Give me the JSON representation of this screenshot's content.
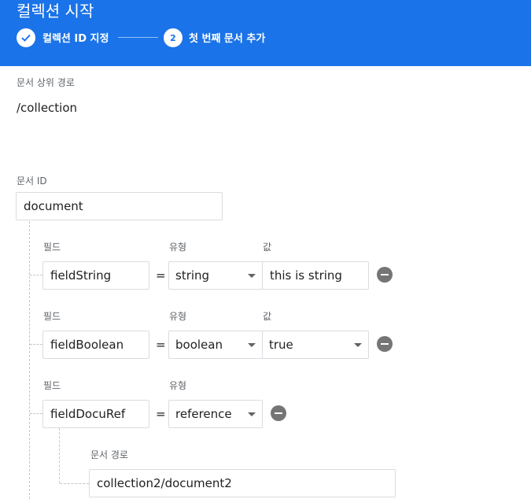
{
  "header": {
    "title": "컬렉션 시작",
    "steps": [
      {
        "label": "컬렉션 ID 지정",
        "status": "done",
        "icon": "check-icon"
      },
      {
        "number": "2",
        "label": "첫 번째 문서 추가",
        "status": "active"
      }
    ]
  },
  "parent_path": {
    "label": "문서 상위 경로",
    "value": "/collection"
  },
  "document_id": {
    "label": "문서 ID",
    "value": "document"
  },
  "fields": [
    {
      "field_label": "필드",
      "type_label": "유형",
      "value_label": "값",
      "name": "fieldString",
      "equals": "=",
      "type": "string",
      "value": "this is string"
    },
    {
      "field_label": "필드",
      "type_label": "유형",
      "value_label": "값",
      "name": "fieldBoolean",
      "equals": "=",
      "type": "boolean",
      "value": "true"
    },
    {
      "field_label": "필드",
      "type_label": "유형",
      "name": "fieldDocuRef",
      "equals": "=",
      "type": "reference",
      "ref_label": "문서 경로",
      "ref_value": "collection2/document2"
    }
  ],
  "colors": {
    "header_bg": "#1a73e8",
    "remove_button": "#757575"
  }
}
